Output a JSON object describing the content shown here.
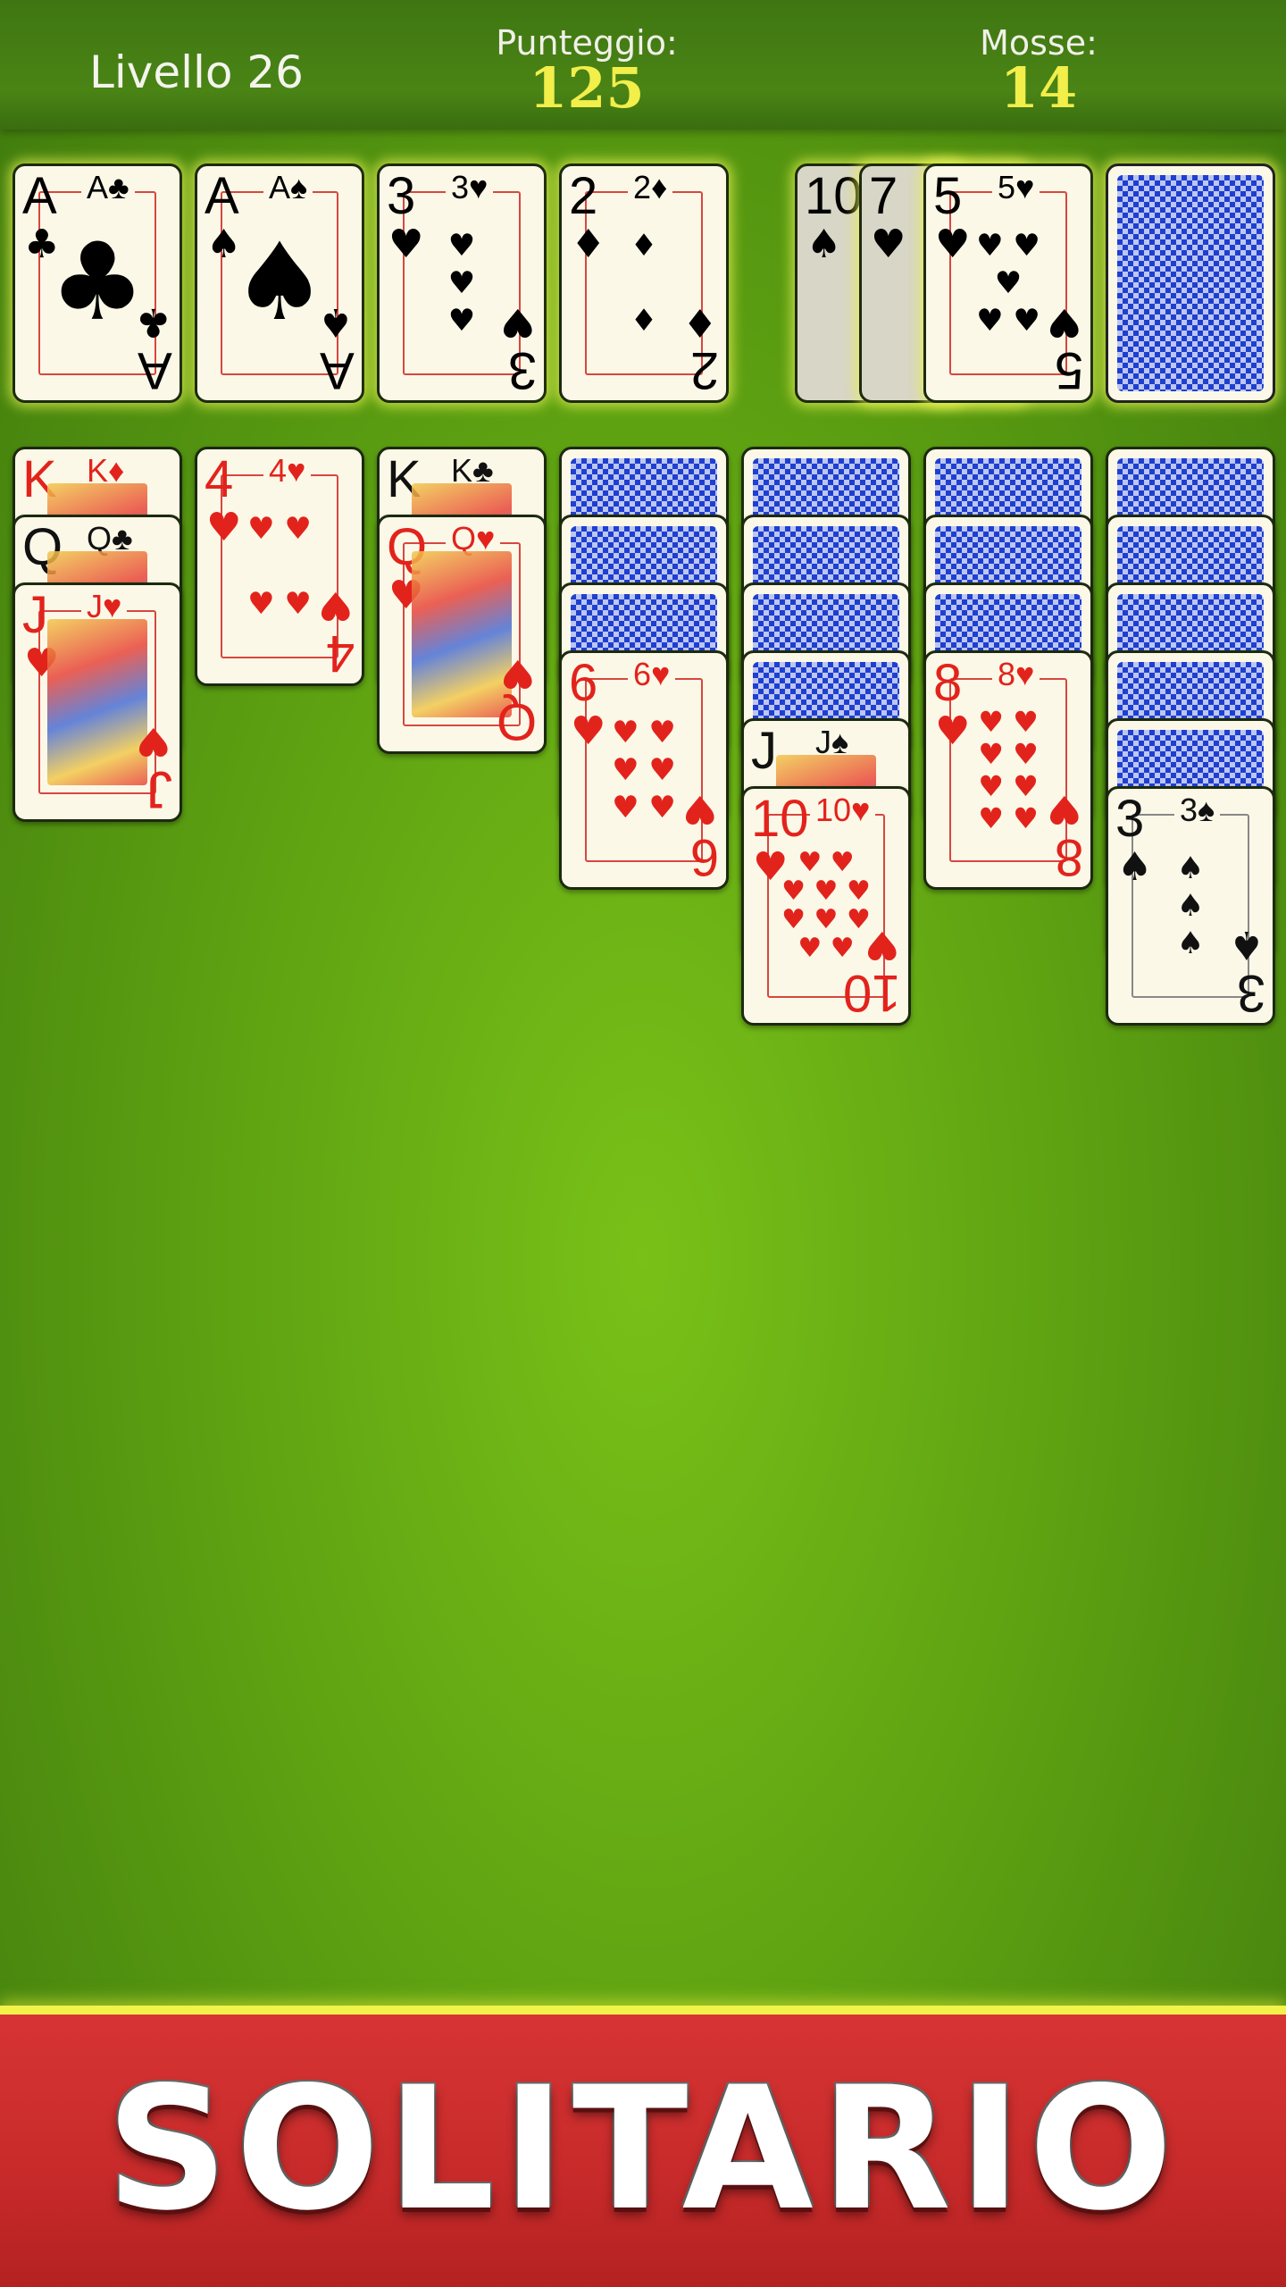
{
  "header": {
    "level": "Livello 26",
    "score_label": "Punteggio:",
    "score_value": "125",
    "moves_label": "Mosse:",
    "moves_value": "14"
  },
  "foundations": [
    {
      "rank": "A",
      "suit": "♣",
      "color": "black"
    },
    {
      "rank": "A",
      "suit": "♠",
      "color": "black"
    },
    {
      "rank": "3",
      "suit": "♥",
      "color": "red"
    },
    {
      "rank": "2",
      "suit": "♦",
      "color": "red"
    }
  ],
  "waste": [
    {
      "rank": "10",
      "suit": "♠",
      "color": "black"
    },
    {
      "rank": "7",
      "suit": "♥",
      "color": "red"
    },
    {
      "rank": "5",
      "suit": "♥",
      "color": "red"
    }
  ],
  "tableau": [
    {
      "cards": [
        {
          "rank": "K",
          "suit": "♦",
          "color": "red"
        },
        {
          "rank": "Q",
          "suit": "♣",
          "color": "black"
        },
        {
          "rank": "J",
          "suit": "♥",
          "color": "red"
        }
      ]
    },
    {
      "cards": [
        {
          "rank": "4",
          "suit": "♥",
          "color": "red"
        }
      ]
    },
    {
      "cards": [
        {
          "rank": "K",
          "suit": "♣",
          "color": "black"
        },
        {
          "rank": "Q",
          "suit": "♥",
          "color": "red"
        }
      ]
    },
    {
      "cards": [
        {
          "rank": "6",
          "suit": "♥",
          "color": "red"
        }
      ]
    },
    {
      "cards": [
        {
          "rank": "J",
          "suit": "♠",
          "color": "black"
        },
        {
          "rank": "10",
          "suit": "♥",
          "color": "red"
        }
      ]
    },
    {
      "cards": [
        {
          "rank": "8",
          "suit": "♥",
          "color": "red"
        }
      ]
    },
    {
      "cards": [
        {
          "rank": "3",
          "suit": "♠",
          "color": "black"
        }
      ]
    }
  ],
  "banner": {
    "title": "SOLITARIO"
  }
}
